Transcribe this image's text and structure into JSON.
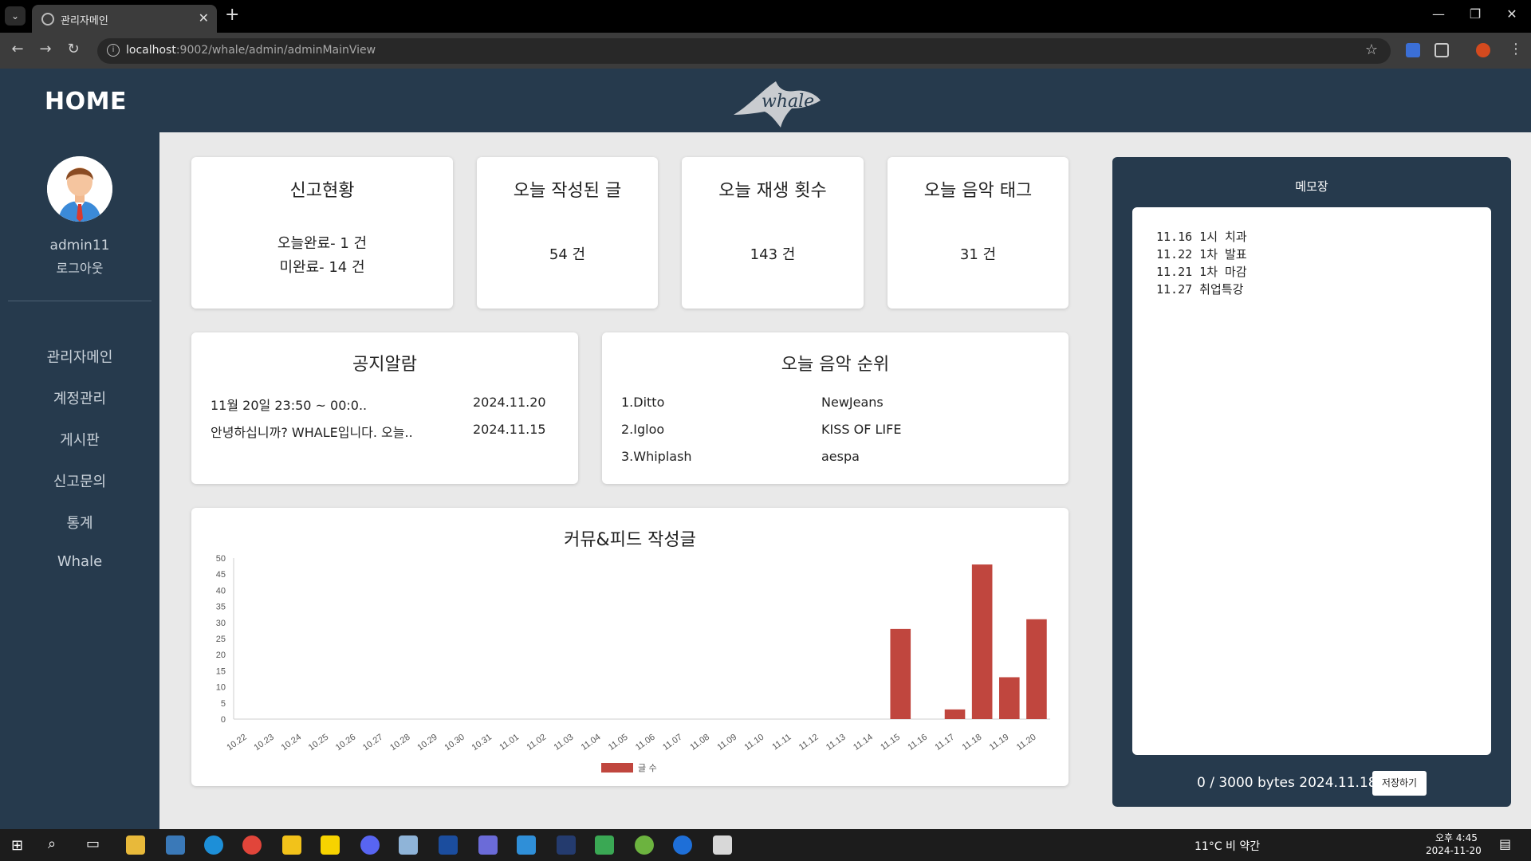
{
  "browser": {
    "tab_title": "관리자메인",
    "url_host": "localhost",
    "url_path": ":9002/whale/admin/adminMainView"
  },
  "header": {
    "home": "HOME",
    "logo_text": "whale"
  },
  "sidebar": {
    "username": "admin11",
    "logout": "로그아웃",
    "items": [
      {
        "label": "관리자메인"
      },
      {
        "label": "계정관리"
      },
      {
        "label": "게시판"
      },
      {
        "label": "신고문의"
      },
      {
        "label": "통계"
      },
      {
        "label": "Whale"
      }
    ]
  },
  "stats": {
    "report": {
      "title": "신고현황",
      "done": "오늘완료- 1 건",
      "pending": "미완료- 14 건"
    },
    "posts": {
      "title": "오늘 작성된 글",
      "value": "54 건"
    },
    "plays": {
      "title": "오늘 재생 횟수",
      "value": "143 건"
    },
    "tags": {
      "title": "오늘 음악 태그",
      "value": "31 건"
    }
  },
  "notice": {
    "title": "공지알람",
    "rows": [
      {
        "text": "11월 20일 23:50 ~ 00:0..",
        "date": "2024.11.20"
      },
      {
        "text": "안녕하십니까? WHALE입니다. 오늘..",
        "date": "2024.11.15"
      }
    ]
  },
  "ranking": {
    "title": "오늘 음악 순위",
    "rows": [
      {
        "song": "1.Ditto",
        "artist": "NewJeans"
      },
      {
        "song": "2.Igloo",
        "artist": "KISS OF LIFE"
      },
      {
        "song": "3.Whiplash",
        "artist": "aespa"
      }
    ]
  },
  "chart_data": {
    "type": "bar",
    "title": "커뮤&피드 작성글",
    "categories": [
      "10.22",
      "10.23",
      "10.24",
      "10.25",
      "10.26",
      "10.27",
      "10.28",
      "10.29",
      "10.30",
      "10.31",
      "11.01",
      "11.02",
      "11.03",
      "11.04",
      "11.05",
      "11.06",
      "11.07",
      "11.08",
      "11.09",
      "11.10",
      "11.11",
      "11.12",
      "11.13",
      "11.14",
      "11.15",
      "11.16",
      "11.17",
      "11.18",
      "11.19",
      "11.20"
    ],
    "series": [
      {
        "name": "글 수",
        "values": [
          0,
          0,
          0,
          0,
          0,
          0,
          0,
          0,
          0,
          0,
          0,
          0,
          0,
          0,
          0,
          0,
          0,
          0,
          0,
          0,
          0,
          0,
          0,
          0,
          28,
          0,
          3,
          48,
          13,
          31
        ]
      }
    ],
    "ylim": [
      0,
      50
    ],
    "yticks": [
      0,
      5,
      10,
      15,
      20,
      25,
      30,
      35,
      40,
      45,
      50
    ],
    "color": "#c0463e",
    "legend": "bottom"
  },
  "memo": {
    "title": "메모장",
    "lines": [
      "11.16 1시 치과",
      "11.22 1차 발표",
      "11.21 1차 마감",
      "11.27 취업특강"
    ],
    "footer": "0 / 3000 bytes 2024.11.18",
    "save": "저장하기"
  },
  "taskbar": {
    "weather": "11°C  비 약간",
    "time": "오후 4:45",
    "date": "2024-11-20"
  }
}
